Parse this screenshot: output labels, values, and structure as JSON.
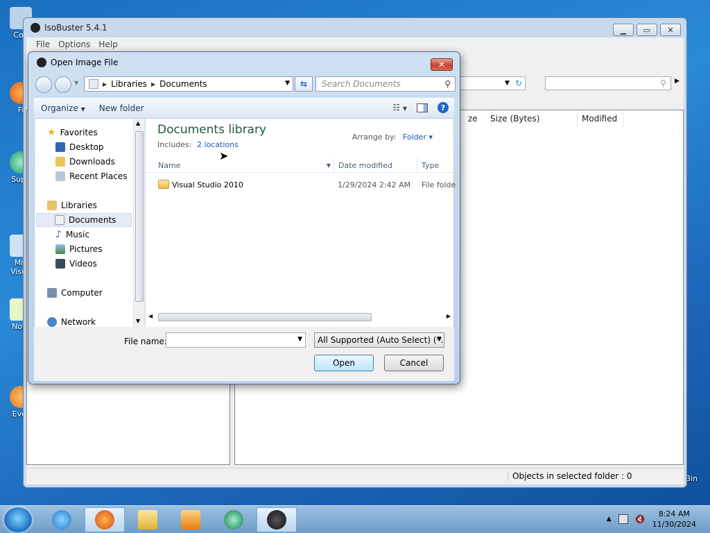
{
  "desktop": {
    "icons": [
      {
        "label": "Con"
      },
      {
        "label": "Fi"
      },
      {
        "label": "Supe"
      },
      {
        "label": "Mic Visua"
      },
      {
        "label": "Note"
      },
      {
        "label": "Ever"
      }
    ],
    "right_label": "Bin"
  },
  "main_window": {
    "title": "IsoBuster 5.4.1",
    "menu": [
      "File",
      "Options",
      "Help"
    ],
    "columns": {
      "size_partial": "ze",
      "size_bytes": "Size (Bytes)",
      "modified": "Modified"
    },
    "status": "Objects in selected folder : 0"
  },
  "dialog": {
    "title": "Open Image File",
    "breadcrumb": [
      "Libraries",
      "Documents"
    ],
    "search_placeholder": "Search Documents",
    "toolbar": {
      "organize": "Organize",
      "new_folder": "New folder"
    },
    "nav": {
      "favorites": "Favorites",
      "desktop": "Desktop",
      "downloads": "Downloads",
      "recent": "Recent Places",
      "libraries": "Libraries",
      "documents": "Documents",
      "music": "Music",
      "pictures": "Pictures",
      "videos": "Videos",
      "computer": "Computer",
      "network": "Network"
    },
    "library_title": "Documents library",
    "includes_label": "Includes:",
    "includes_link": "2 locations",
    "arrange_label": "Arrange by:",
    "arrange_value": "Folder",
    "columns": {
      "name": "Name",
      "date": "Date modified",
      "type": "Type"
    },
    "files": [
      {
        "name": "Visual Studio 2010",
        "date": "1/29/2024 2:42 AM",
        "type": "File folder"
      }
    ],
    "file_name_label": "File name:",
    "file_name_value": "",
    "file_type": "All Supported (Auto Select) (*.IS",
    "open_label": "Open",
    "cancel_label": "Cancel"
  },
  "taskbar": {
    "time": "8:24 AM",
    "date": "11/30/2024"
  }
}
